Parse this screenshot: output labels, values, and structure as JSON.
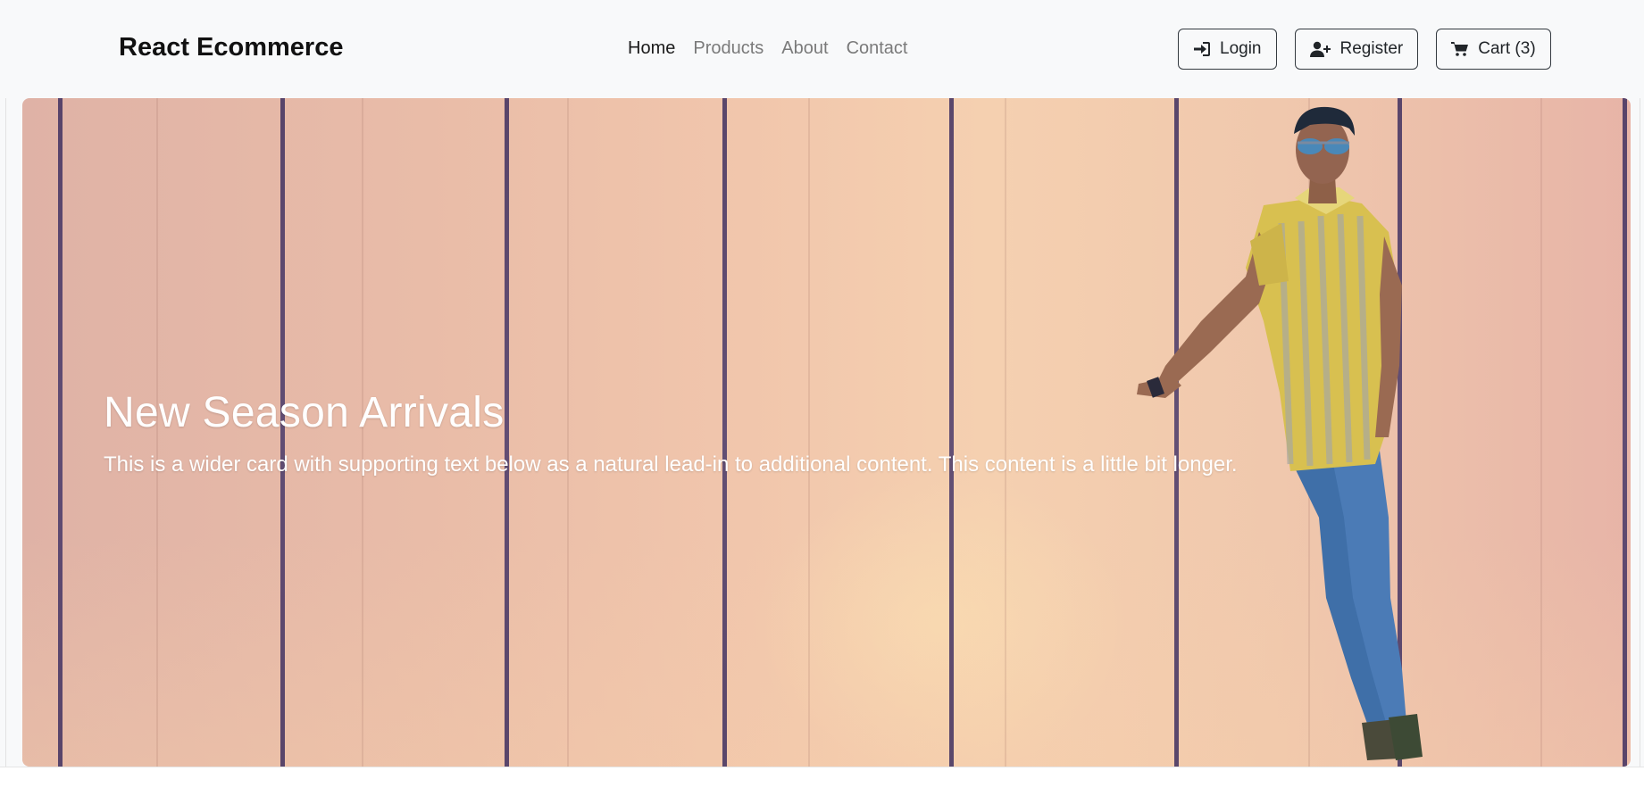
{
  "navbar": {
    "brand": "React Ecommerce",
    "links": [
      {
        "label": "Home",
        "active": true
      },
      {
        "label": "Products",
        "active": false
      },
      {
        "label": "About",
        "active": false
      },
      {
        "label": "Contact",
        "active": false
      }
    ],
    "buttons": {
      "login": {
        "label": "Login",
        "icon": "sign-in-icon"
      },
      "register": {
        "label": "Register",
        "icon": "user-plus-icon"
      },
      "cart": {
        "label": "Cart (3)",
        "icon": "shopping-cart-icon"
      }
    }
  },
  "hero": {
    "title": "New Season Arrivals",
    "text": "This is a wider card with supporting text below as a natural lead-in to additional content. This content is a little bit longer."
  },
  "colors": {
    "text_dark": "#212529",
    "nav_muted": "#7a7a7a",
    "hero_text": "#ffffff",
    "plank_line": "#3f2f5f"
  }
}
